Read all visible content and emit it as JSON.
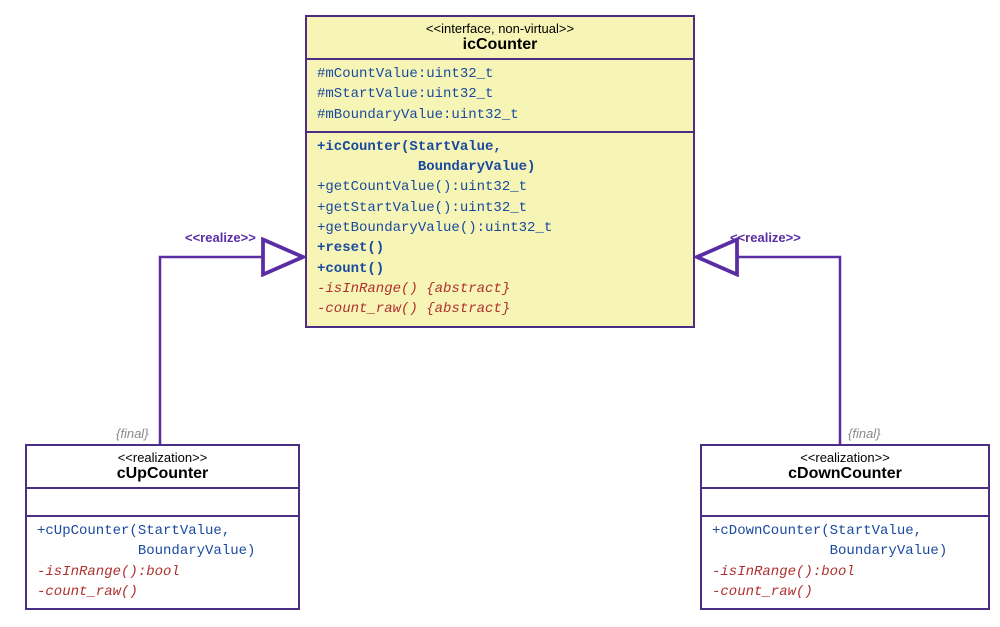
{
  "interface": {
    "stereotype": "<<interface, non-virtual>>",
    "name": "icCounter",
    "attributes": [
      "#mCountValue:uint32_t",
      "#mStartValue:uint32_t",
      "#mBoundaryValue:uint32_t"
    ],
    "methods": [
      {
        "text": "+icCounter(StartValue,",
        "cls": "meth bold"
      },
      {
        "text": "            BoundaryValue)",
        "cls": "meth bold"
      },
      {
        "text": "+getCountValue():uint32_t",
        "cls": "meth"
      },
      {
        "text": "+getStartValue():uint32_t",
        "cls": "meth"
      },
      {
        "text": "+getBoundaryValue():uint32_t",
        "cls": "meth"
      },
      {
        "text": "+reset()",
        "cls": "meth bold"
      },
      {
        "text": "+count()",
        "cls": "meth bold"
      },
      {
        "text": "-isInRange() {abstract}",
        "cls": "abstract"
      },
      {
        "text": "-count_raw() {abstract}",
        "cls": "abstract"
      }
    ]
  },
  "upcounter": {
    "stereotype": "<<realization>>",
    "name": "cUpCounter",
    "methods": [
      {
        "text": "+cUpCounter(StartValue,",
        "cls": "meth"
      },
      {
        "text": "            BoundaryValue)",
        "cls": "meth"
      },
      {
        "text": "-isInRange():bool",
        "cls": "abstract"
      },
      {
        "text": "-count_raw()",
        "cls": "abstract"
      }
    ]
  },
  "downcounter": {
    "stereotype": "<<realization>>",
    "name": "cDownCounter",
    "methods": [
      {
        "text": "+cDownCounter(StartValue,",
        "cls": "meth"
      },
      {
        "text": "              BoundaryValue)",
        "cls": "meth"
      },
      {
        "text": "-isInRange():bool",
        "cls": "abstract"
      },
      {
        "text": "-count_raw()",
        "cls": "abstract"
      }
    ]
  },
  "labels": {
    "realize": "<<realize>>",
    "final": "{final}"
  }
}
